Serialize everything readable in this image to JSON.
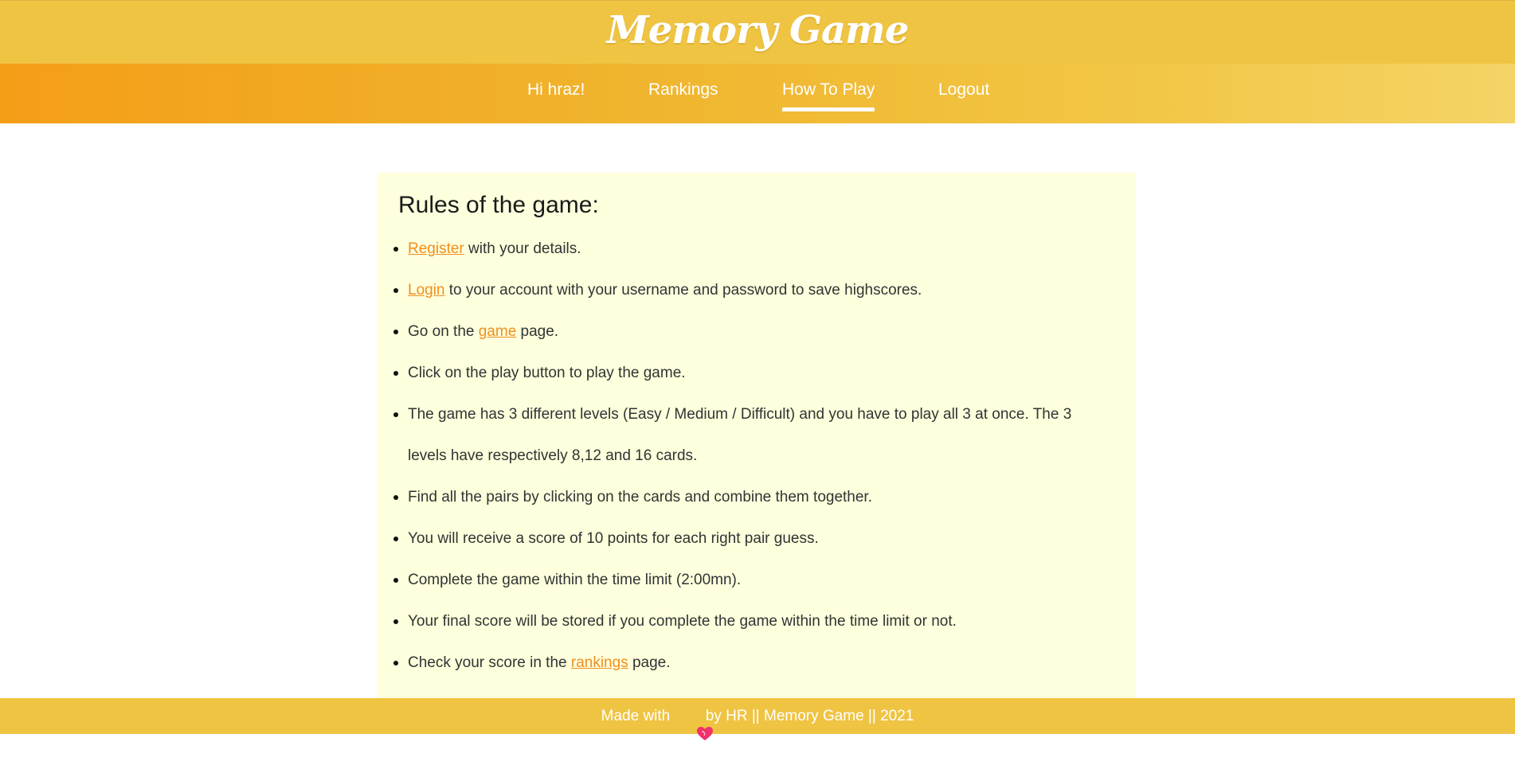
{
  "header": {
    "logo": "Memory Game"
  },
  "nav": {
    "items": [
      {
        "label": "Hi hraz!"
      },
      {
        "label": "Rankings"
      },
      {
        "label": "How To Play"
      },
      {
        "label": "Logout"
      }
    ],
    "active": "How To Play"
  },
  "rules": {
    "title": "Rules of the game:",
    "items": [
      {
        "link": "Register",
        "after": " with your details."
      },
      {
        "link": "Login",
        "after": " to your account with your username and password to save highscores."
      },
      {
        "before": "Go on the ",
        "link": "game",
        "after": " page."
      },
      {
        "text": "Click on the play button to play the game."
      },
      {
        "text": "The game has 3 different levels (Easy / Medium / Difficult) and you have to play all 3 at once. The 3 levels have respectively 8,12 and 16 cards."
      },
      {
        "text": "Find all the pairs by clicking on the cards and combine them together."
      },
      {
        "text": "You will receive a score of 10 points for each right pair guess."
      },
      {
        "text": "Complete the game within the time limit (2:00mn)."
      },
      {
        "text": "Your final score will be stored if you complete the game within the time limit or not."
      },
      {
        "before": "Check your score in the ",
        "link": "rankings",
        "after": " page."
      }
    ]
  },
  "footer": {
    "before": "Made with ",
    "icon": "heart-icon",
    "after": " by HR || Memory Game || 2021"
  },
  "colors": {
    "header_bg": "#efc443",
    "nav_gradient_start": "#f49e18",
    "nav_gradient_end": "#f4d466",
    "panel_bg": "#feffdd",
    "link": "#f08f1e",
    "heart": "#f0336b"
  }
}
